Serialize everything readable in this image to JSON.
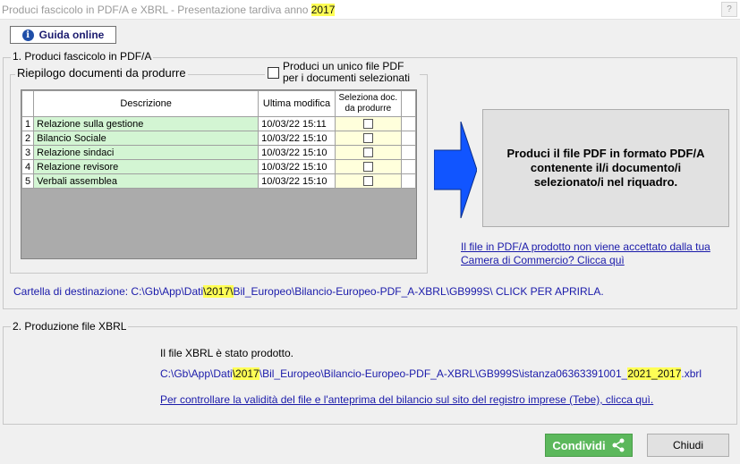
{
  "window": {
    "title_prefix": "Produci fascicolo in PDF/A e XBRL - Presentazione tardiva anno ",
    "title_year": "2017",
    "title_button": "?"
  },
  "toolbar": {
    "guida_label": "Guida online",
    "guida_icon": "info-icon"
  },
  "section1": {
    "legend": "1. Produci fascicolo in PDF/A",
    "inner_legend": "Riepilogo documenti da produrre",
    "single_file_label": "Produci un unico file PDF per i documenti selezionati",
    "single_file_checked": false,
    "table": {
      "headers": [
        "",
        "Descrizione",
        "Ultima modifica",
        "Seleziona doc. da produrre"
      ],
      "rows": [
        {
          "n": "1",
          "descr": "Relazione sulla gestione",
          "date": "10/03/22 15:11",
          "selected": false
        },
        {
          "n": "2",
          "descr": "Bilancio Sociale",
          "date": "10/03/22 15:10",
          "selected": false
        },
        {
          "n": "3",
          "descr": "Relazione sindaci",
          "date": "10/03/22 15:10",
          "selected": false
        },
        {
          "n": "4",
          "descr": "Relazione revisore",
          "date": "10/03/22 15:10",
          "selected": false
        },
        {
          "n": "5",
          "descr": "Verbali assemblea",
          "date": "10/03/22 15:10",
          "selected": false
        }
      ]
    },
    "produce_button": "Produci il file PDF in formato PDF/A contenente il/i documento/i selezionato/i nel riquadro.",
    "pdfa_link_line1": "Il file in PDF/A prodotto non viene accettato dalla tua",
    "pdfa_link_line2": "Camera di Commercio? Clicca quì",
    "dest_label": "Cartella di destinazione: ",
    "dest_path_a": "C:\\Gb\\App\\Dati",
    "dest_path_year": "\\2017\\",
    "dest_path_b": "Bil_Europeo\\Bilancio-Europeo-PDF_A-XBRL\\GB999S\\  CLICK PER APRIRLA."
  },
  "section2": {
    "legend": "2. Produzione file XBRL",
    "message": "Il file XBRL è stato prodotto.",
    "path_a": "C:\\Gb\\App\\Dati",
    "path_year": "\\2017",
    "path_b": "\\Bil_Europeo\\Bilancio-Europeo-PDF_A-XBRL\\GB999S\\istanza06363391001_",
    "path_years": "2021_2017",
    "path_ext": ".xbrl",
    "check_link": "Per controllare la validità del file e l'anteprima del bilancio sul sito del registro imprese (Tebe), clicca quì."
  },
  "footer": {
    "share_label": "Condividi",
    "share_icon": "share-icon",
    "close_label": "Chiudi",
    "share_color": "#5cb85c"
  },
  "colors": {
    "highlight": "#ffff55",
    "link": "#1a1aaa",
    "arrow": "#1155ff"
  }
}
